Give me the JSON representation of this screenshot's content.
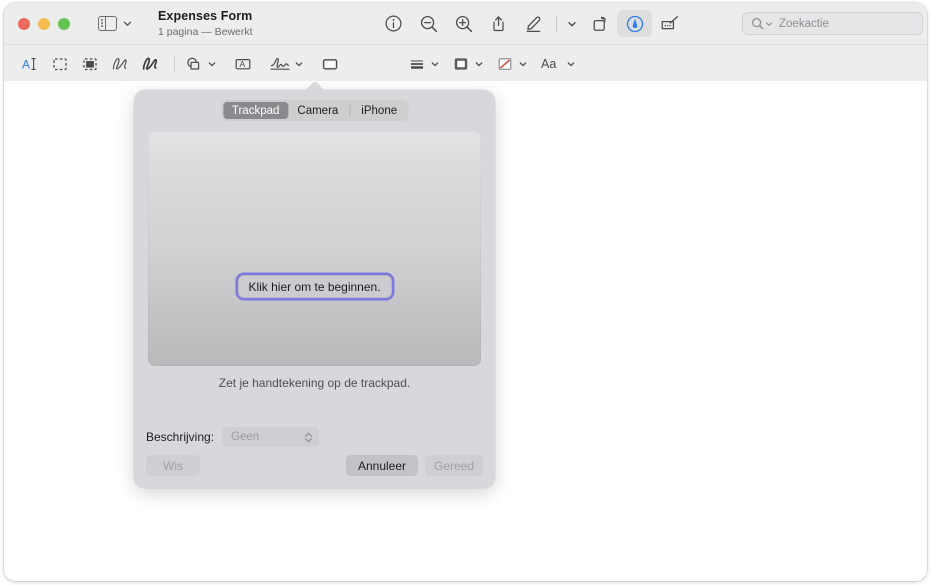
{
  "window": {
    "traffic_lights": [
      {
        "name": "close",
        "color": "#ed6a5e"
      },
      {
        "name": "minimize",
        "color": "#f4be4f"
      },
      {
        "name": "zoom",
        "color": "#61c455"
      }
    ],
    "title": "Expenses Form",
    "subtitle": "1 pagina — Bewerkt"
  },
  "toolbar": {
    "sidebar_icon": "sidebar-icon",
    "sidebar_chevron_icon": "chevron-down-icon",
    "items": [
      {
        "name": "info-button",
        "icon": "info-circle-icon"
      },
      {
        "name": "zoom-out-button",
        "icon": "magnifier-minus-icon"
      },
      {
        "name": "zoom-in-button",
        "icon": "magnifier-plus-icon"
      },
      {
        "name": "share-button",
        "icon": "share-icon"
      },
      {
        "name": "highlight-button",
        "icon": "highlighter-pen-icon"
      },
      {
        "name": "highlight-options-chevron",
        "icon": "chevron-down-icon"
      },
      {
        "name": "rotate-button",
        "icon": "rotate-icon"
      },
      {
        "name": "markup-button",
        "icon": "markup-pen-circle-icon",
        "active": true,
        "color": "#2f7cf6"
      },
      {
        "name": "signature-toolbar-button",
        "icon": "signature-pad-icon"
      }
    ],
    "search": {
      "placeholder": "Zoekactie",
      "icon": "magnifier-icon",
      "chevron": "chevron-down-icon"
    }
  },
  "markup_toolbar": {
    "items": [
      {
        "name": "text-selection-tool",
        "icon": "text-cursor-a-icon",
        "accent": "#2f7cf6"
      },
      {
        "name": "rectangular-selection-tool",
        "icon": "dashed-rectangle-icon"
      },
      {
        "name": "instant-alpha-tool",
        "icon": "filled-dashed-square-icon"
      },
      {
        "name": "sketch-tool",
        "icon": "sketch-squiggle-icon"
      },
      {
        "name": "draw-tool",
        "icon": "draw-squiggle-icon"
      },
      {
        "name": "shapes-tool",
        "icon": "shapes-icon",
        "chevron": true
      },
      {
        "name": "text-tool",
        "icon": "text-box-a-icon"
      },
      {
        "name": "signature-tool",
        "icon": "signature-icon",
        "chevron": true,
        "active": true
      },
      {
        "name": "note-tool",
        "icon": "note-rectangle-icon"
      },
      {
        "name": "shape-style-tool",
        "icon": "line-weight-icon",
        "chevron": true
      },
      {
        "name": "border-color-tool",
        "icon": "border-color-square-icon",
        "chevron": true
      },
      {
        "name": "fill-color-tool",
        "icon": "fill-none-diagonal-icon",
        "chevron": true
      },
      {
        "name": "text-style-tool",
        "icon": "font-aa-icon",
        "chevron": true
      }
    ]
  },
  "signature_popover": {
    "tabs": [
      {
        "label": "Trackpad",
        "selected": true
      },
      {
        "label": "Camera",
        "selected": false
      },
      {
        "label": "iPhone",
        "selected": false
      }
    ],
    "start_button_label": "Klik hier om te beginnen.",
    "hint_text": "Zet je handtekening op de trackpad.",
    "description_label": "Beschrijving:",
    "description_value": "Geen",
    "description_chevron_icon": "updown-chevron-icon",
    "buttons": [
      {
        "name": "clear-button",
        "label": "Wis",
        "state": "disabled"
      },
      {
        "name": "cancel-button",
        "label": "Annuleer",
        "state": "normal"
      },
      {
        "name": "done-button",
        "label": "Gereed",
        "state": "disabled"
      }
    ]
  }
}
